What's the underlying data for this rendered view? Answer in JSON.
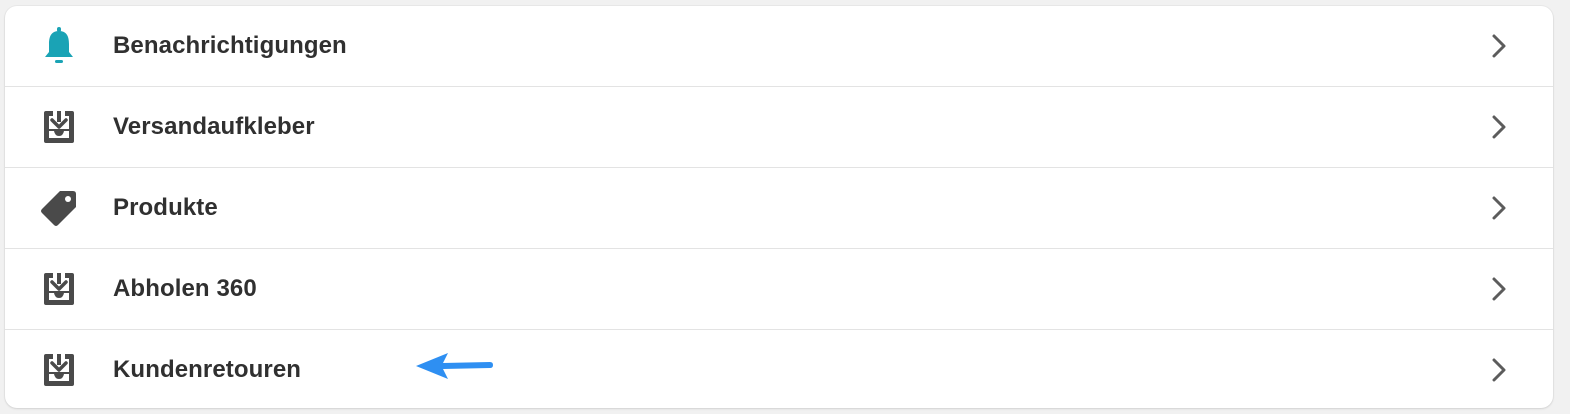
{
  "settings_list": {
    "items": [
      {
        "label": "Benachrichtigungen",
        "icon": "bell-icon",
        "icon_color": "#1aa3b5"
      },
      {
        "label": "Versandaufkleber",
        "icon": "inbox-download-icon",
        "icon_color": "#4a4a4a"
      },
      {
        "label": "Produkte",
        "icon": "tag-icon",
        "icon_color": "#4a4a4a"
      },
      {
        "label": "Abholen 360",
        "icon": "inbox-download-icon",
        "icon_color": "#4a4a4a"
      },
      {
        "label": "Kundenretouren",
        "icon": "inbox-download-icon",
        "icon_color": "#4a4a4a"
      }
    ]
  },
  "chevron_icon": "chevron-right-icon",
  "chevron_color": "#5c5c5c",
  "annotation": {
    "icon": "arrow-left-icon",
    "color": "#2e8ff2"
  }
}
